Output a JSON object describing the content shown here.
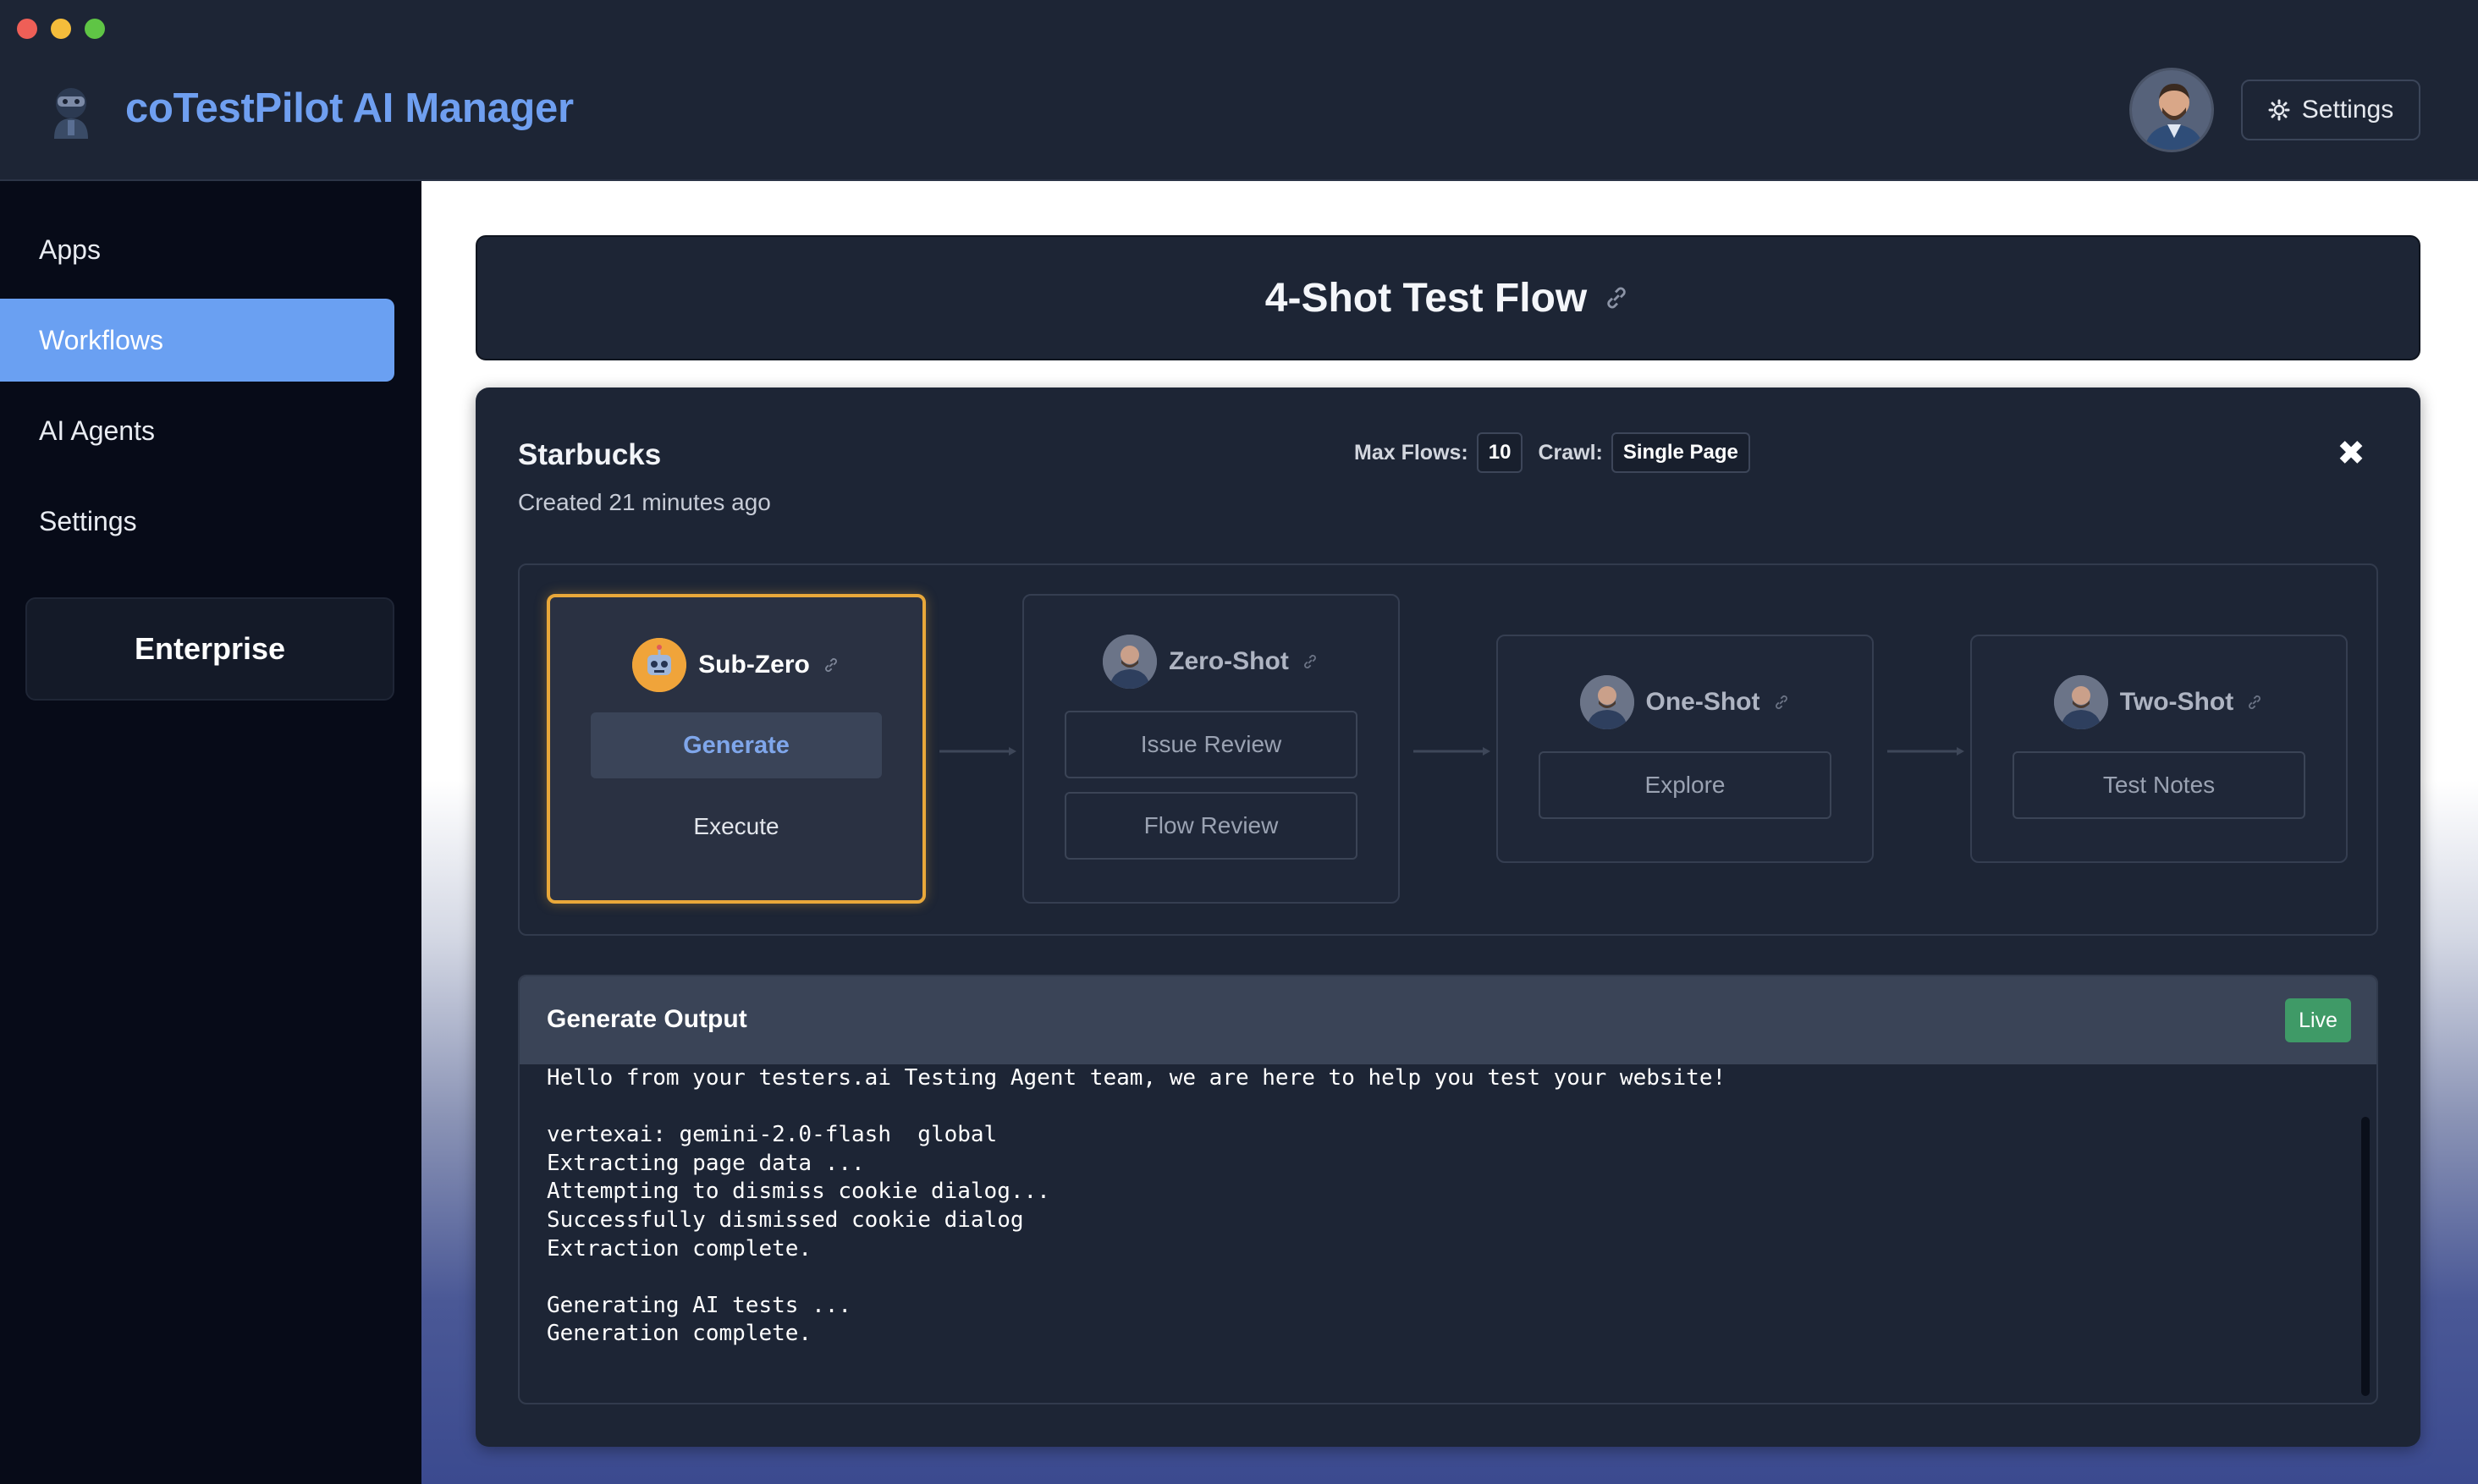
{
  "header": {
    "app_title": "coTestPilot AI Manager",
    "settings_label": "Settings"
  },
  "sidebar": {
    "items": [
      {
        "label": "Apps"
      },
      {
        "label": "Workflows"
      },
      {
        "label": "AI Agents"
      },
      {
        "label": "Settings"
      }
    ],
    "active": "Workflows",
    "enterprise_label": "Enterprise"
  },
  "flow": {
    "title": "4-Shot Test Flow"
  },
  "project": {
    "name": "Starbucks",
    "created": "Created 21 minutes ago",
    "max_flows_label": "Max Flows:",
    "max_flows_value": "10",
    "crawl_label": "Crawl:",
    "crawl_value": "Single Page",
    "close_symbol": "✖"
  },
  "nodes": [
    {
      "name": "Sub-Zero",
      "buttons": [
        "Generate",
        "Execute"
      ],
      "active": true
    },
    {
      "name": "Zero-Shot",
      "buttons": [
        "Issue Review",
        "Flow Review"
      ]
    },
    {
      "name": "One-Shot",
      "buttons": [
        "Explore"
      ]
    },
    {
      "name": "Two-Shot",
      "buttons": [
        "Test Notes"
      ]
    }
  ],
  "output": {
    "title": "Generate Output",
    "status": "Live",
    "lines": [
      "Hello from your testers.ai Testing Agent team, we are here to help you test your website!",
      "",
      "vertexai: gemini-2.0-flash  global",
      "Extracting page data ...",
      "Attempting to dismiss cookie dialog...",
      "Successfully dismissed cookie dialog",
      "Extraction complete.",
      "",
      "Generating AI tests ...",
      "Generation complete."
    ]
  },
  "colors": {
    "accent": "#6aa0f2",
    "active_node_border": "#e9a83a",
    "live_badge": "#3f9a67",
    "panel": "#1d2535"
  },
  "icons": [
    "robot-icon",
    "gear-icon",
    "link-icon",
    "close-icon",
    "arrow-right-icon"
  ]
}
